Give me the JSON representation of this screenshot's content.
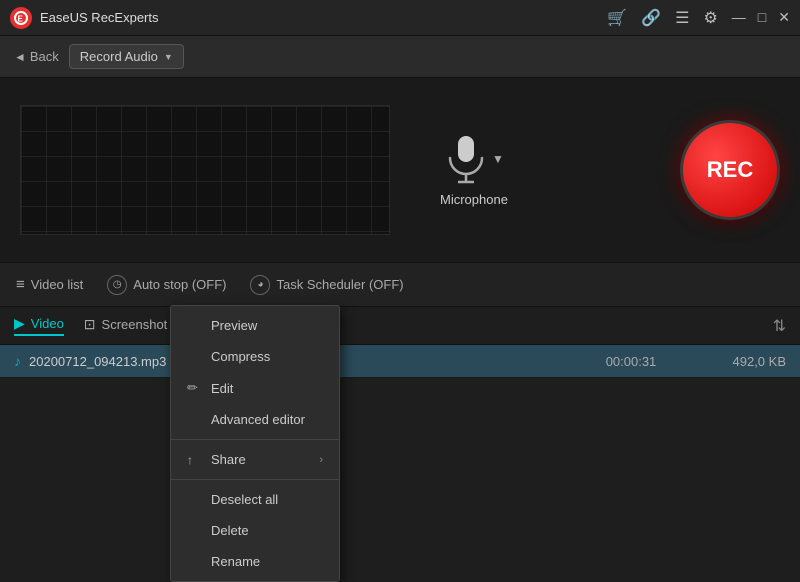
{
  "titlebar": {
    "logo_text": "E",
    "app_name": "EaseUS RecExperts",
    "icons": {
      "cart": "🛒",
      "settings_alt": "🔧",
      "menu": "☰",
      "settings": "⚙",
      "minimize": "—",
      "maximize": "□",
      "close": "✕"
    }
  },
  "toolbar": {
    "back_label": "Back",
    "record_audio_label": "Record Audio"
  },
  "waveform": {
    "label": "waveform"
  },
  "microphone": {
    "label": "Microphone",
    "dropdown_arrow": "▼"
  },
  "rec_button": {
    "label": "REC"
  },
  "bottom_toolbar": {
    "video_list_label": "Video list",
    "auto_stop_label": "Auto stop (OFF)",
    "task_scheduler_label": "Task Scheduler (OFF)"
  },
  "file_tabs": {
    "video_label": "Video",
    "screenshot_label": "Screenshot"
  },
  "file_row": {
    "filename": "20200712_094213.mp3",
    "duration": "00:00:31",
    "size": "492,0 KB"
  },
  "context_menu": {
    "items": [
      {
        "id": "preview",
        "label": "Preview",
        "icon": ""
      },
      {
        "id": "compress",
        "label": "Compress",
        "icon": ""
      },
      {
        "id": "edit",
        "label": "Edit",
        "icon": "✏"
      },
      {
        "id": "advanced-editor",
        "label": "Advanced editor",
        "icon": ""
      },
      {
        "id": "share",
        "label": "Share",
        "icon": "↑",
        "has_arrow": true
      },
      {
        "id": "deselect-all",
        "label": "Deselect all",
        "icon": ""
      },
      {
        "id": "delete",
        "label": "Delete",
        "icon": ""
      },
      {
        "id": "rename",
        "label": "Rename",
        "icon": ""
      }
    ]
  },
  "colors": {
    "accent": "#00c8c8",
    "rec_red": "#cc0000",
    "bg_dark": "#1a1a1a",
    "bg_mid": "#2b2b2b"
  }
}
